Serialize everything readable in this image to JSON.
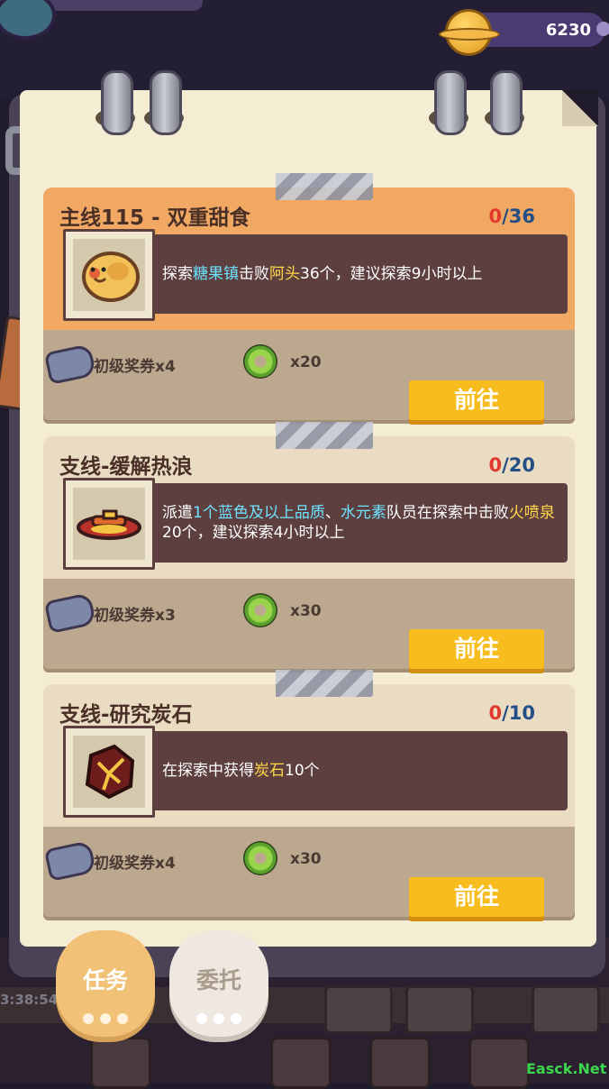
{
  "currency": {
    "value": "6230",
    "icon": "gold-planet-coin-icon"
  },
  "cards": [
    {
      "title": "主线115 - 双重甜食",
      "progress_current": "0",
      "progress_total": "/36",
      "desc_parts": [
        {
          "text": "探索"
        },
        {
          "text": "糖果镇",
          "style": "blue"
        },
        {
          "text": "击败"
        },
        {
          "text": "阿头",
          "style": "yellow"
        },
        {
          "text": "36个，建议探索9小时以上"
        }
      ],
      "icon": "cookie-monster-icon",
      "rewards": [
        {
          "label": "初级奖券x4",
          "icon": "ticket-icon"
        },
        {
          "label": "x20",
          "icon": "green-donut-icon"
        }
      ],
      "button": "前往",
      "theme": "orange"
    },
    {
      "title": "支线-缓解热浪",
      "progress_current": "0",
      "progress_total": "/20",
      "desc_parts": [
        {
          "text": "派遣"
        },
        {
          "text": "1个蓝色及以上品质",
          "style": "blue"
        },
        {
          "text": "、"
        },
        {
          "text": "水元素",
          "style": "blue"
        },
        {
          "text": "队员在探索中击败"
        },
        {
          "text": "火喷泉",
          "style": "yellow"
        },
        {
          "text": "20个，建议探索4小时以上"
        }
      ],
      "icon": "fire-fountain-icon",
      "rewards": [
        {
          "label": "初级奖券x3",
          "icon": "ticket-icon"
        },
        {
          "label": "x30",
          "icon": "green-donut-icon"
        }
      ],
      "button": "前往",
      "theme": "beige"
    },
    {
      "title": "支线-研究炭石",
      "progress_current": "0",
      "progress_total": "/10",
      "desc_parts": [
        {
          "text": "在探索中获得"
        },
        {
          "text": "炭石",
          "style": "yellow"
        },
        {
          "text": "10个"
        }
      ],
      "icon": "charcoal-stone-icon",
      "rewards": [
        {
          "label": "初级奖券x4",
          "icon": "ticket-icon"
        },
        {
          "label": "x30",
          "icon": "green-donut-icon"
        }
      ],
      "button": "前往",
      "theme": "beige"
    }
  ],
  "tabs": [
    {
      "label": "任务",
      "active": true
    },
    {
      "label": "委托",
      "active": false
    }
  ],
  "timer": "3:38:54",
  "watermark": "Easck.Net",
  "colors": {
    "orange_card": "#f1a863",
    "beige_card": "#e9dcc2",
    "button": "#f7bd1f",
    "desc_bg": "#5e3f3f"
  }
}
